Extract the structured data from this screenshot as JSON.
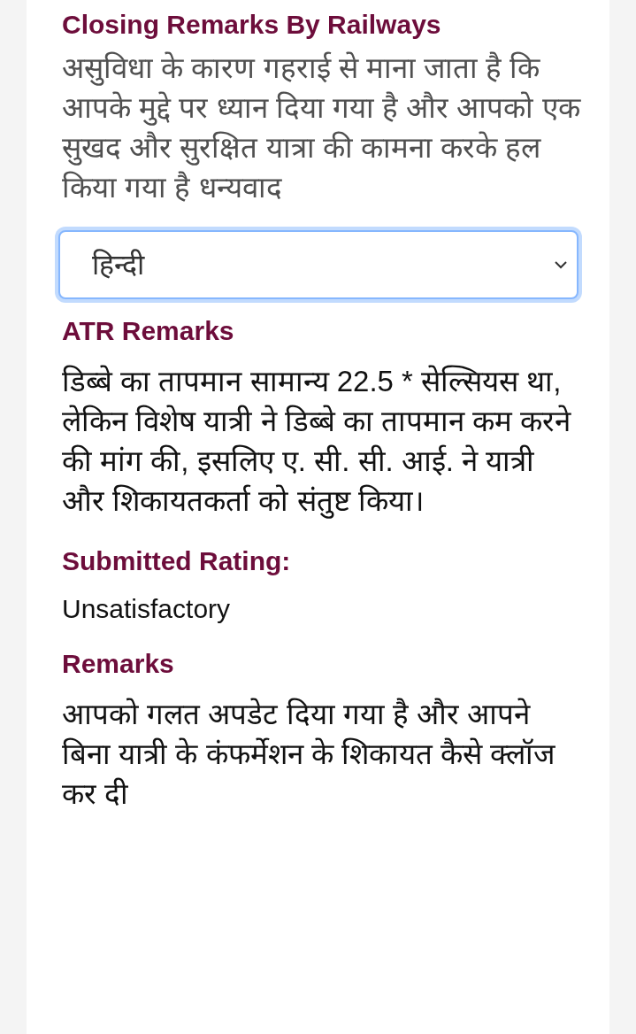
{
  "sections": [
    {
      "kind": "text",
      "heading": "Closing Remarks By Railways",
      "body": "असुविधा के कारण गहराई से माना जाता है कि आपके मुद्दे पर ध्यान दिया गया है और आपको एक सुखद और सुरक्षित यात्रा की कामना करके हल किया गया है धन्यवाद",
      "muted": true
    },
    {
      "kind": "select",
      "value": "हिन्दी",
      "focused": true
    },
    {
      "kind": "text",
      "heading": "ATR Remarks",
      "body": "डिब्बे का तापमान सामान्य 22.5 * सेल्सियस था, लेकिन विशेष यात्री ने डिब्बे का तापमान कम करने की मांग की, इसलिए ए. सी. सी. आई. ने यात्री और शिकायतकर्ता को संतुष्ट किया।",
      "muted": false
    },
    {
      "kind": "rating",
      "heading": "Submitted Rating:",
      "body": "Unsatisfactory"
    },
    {
      "kind": "text",
      "heading": "Remarks",
      "body": "आपको गलत अपडेट दिया गया है और आपने बिना यात्री के कंफर्मेशन के शिकायत कैसे क्लॉज कर दी",
      "muted": false
    }
  ]
}
